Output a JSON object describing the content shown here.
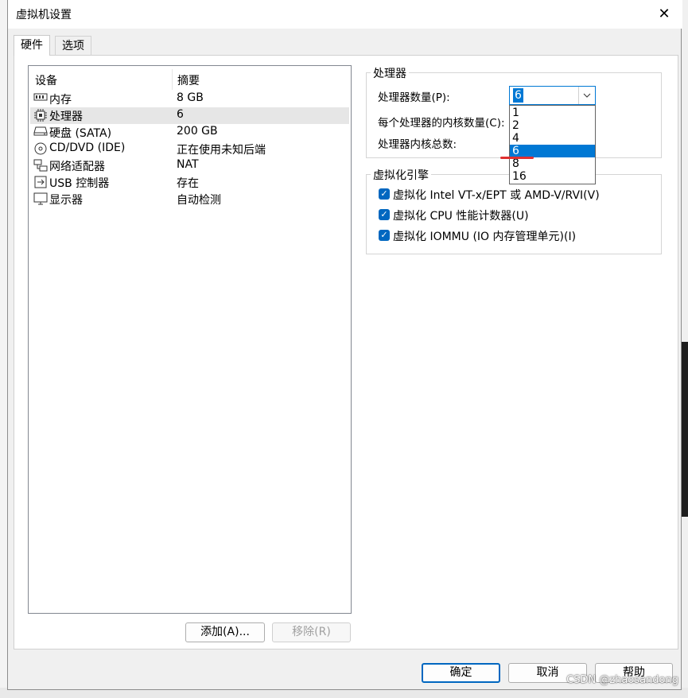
{
  "window": {
    "title": "虚拟机设置"
  },
  "tabs": [
    {
      "label": "硬件",
      "active": true
    },
    {
      "label": "选项",
      "active": false
    }
  ],
  "device_list": {
    "col_device": "设备",
    "col_summary": "摘要",
    "items": [
      {
        "icon": "memory-icon",
        "name": "内存",
        "summary": "8 GB"
      },
      {
        "icon": "processor-icon",
        "name": "处理器",
        "summary": "6",
        "selected": true
      },
      {
        "icon": "harddisk-icon",
        "name": "硬盘 (SATA)",
        "summary": "200 GB"
      },
      {
        "icon": "cd-dvd-icon",
        "name": "CD/DVD (IDE)",
        "summary": "正在使用未知后端"
      },
      {
        "icon": "network-adapter-icon",
        "name": "网络适配器",
        "summary": "NAT"
      },
      {
        "icon": "usb-icon",
        "name": "USB 控制器",
        "summary": "存在"
      },
      {
        "icon": "display-icon",
        "name": "显示器",
        "summary": "自动检测"
      }
    ]
  },
  "buttons": {
    "add": "添加(A)...",
    "remove": "移除(R)",
    "ok": "确定",
    "cancel": "取消",
    "help": "帮助"
  },
  "processor_group": {
    "title": "处理器",
    "count_label": "处理器数量(P):",
    "cores_label": "每个处理器的内核数量(C):",
    "total_label": "处理器内核总数:",
    "count_value": "6",
    "options": [
      "1",
      "2",
      "4",
      "6",
      "8",
      "16"
    ],
    "selected_option": "6"
  },
  "virtualization_group": {
    "title": "虚拟化引擎",
    "options": [
      {
        "label": "虚拟化 Intel VT-x/EPT 或 AMD-V/RVI(V)",
        "checked": true
      },
      {
        "label": "虚拟化 CPU 性能计数器(U)",
        "checked": true
      },
      {
        "label": "虚拟化 IOMMU (IO 内存管理单元)(I)",
        "checked": true
      }
    ]
  },
  "watermark": "CSDN @zhaosandong",
  "colors": {
    "accent": "#0078d4",
    "annotation": "#e03030"
  }
}
